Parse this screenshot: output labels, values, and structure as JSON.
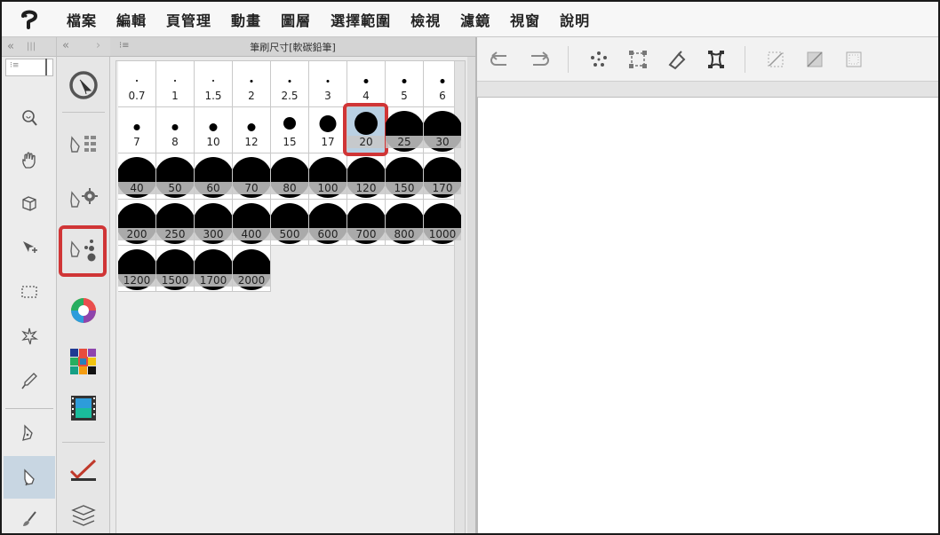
{
  "menu": {
    "items": [
      "檔案",
      "編輯",
      "頁管理",
      "動畫",
      "圖層",
      "選擇範圍",
      "檢視",
      "濾鏡",
      "視窗",
      "說明"
    ]
  },
  "panel": {
    "title": "筆刷尺寸[軟碳鉛筆]",
    "menu_icon": "panel-menu-icon"
  },
  "brush_sizes": [
    "0.7",
    "1",
    "1.5",
    "2",
    "2.5",
    "3",
    "4",
    "5",
    "6",
    "7",
    "8",
    "10",
    "12",
    "15",
    "17",
    "20",
    "25",
    "30",
    "40",
    "50",
    "60",
    "70",
    "80",
    "100",
    "120",
    "150",
    "170",
    "200",
    "250",
    "300",
    "400",
    "500",
    "600",
    "700",
    "800",
    "1000",
    "1200",
    "1500",
    "1700",
    "2000"
  ],
  "selected_brush_size": "20",
  "colors": {
    "highlight": "#d03536",
    "selected_cell": "#b9d0e3"
  },
  "toolbar_icons": [
    "undo-icon",
    "redo-icon",
    "select-dots-icon",
    "transform-icon",
    "fill-icon",
    "crop-icon",
    "ruler-disabled-icon",
    "perspective-disabled-icon",
    "grid-disabled-icon"
  ],
  "tool_icons": [
    "zoom-icon",
    "hand-icon",
    "3d-icon",
    "move-icon",
    "selection-rect-icon",
    "auto-select-icon",
    "eyedropper-icon",
    "pen-icon",
    "pencil-icon",
    "brush-icon"
  ],
  "sub_icons": [
    "sub-tool-icon",
    "tool-property-icon",
    "sub-tool-detail-icon",
    "brush-size-icon",
    "color-wheel-icon",
    "color-set-icon",
    "animation-icon",
    "navigator-icon",
    "layers-icon"
  ]
}
